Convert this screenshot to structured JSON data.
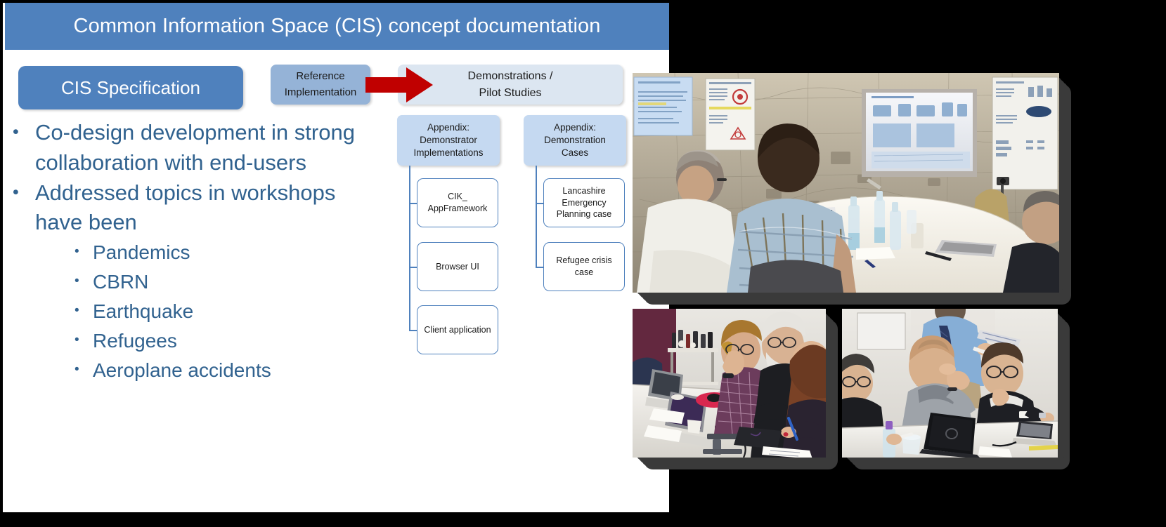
{
  "slide": {
    "title": "Common Information Space (CIS) concept documentation",
    "title_bar_color": "#4f81bd",
    "panel_background": "#ffffff",
    "page_background": "#000000"
  },
  "top_row": {
    "cis_specification": {
      "label": "CIS Specification",
      "color": "#4f81bd",
      "text_color": "#ffffff"
    },
    "reference_implementation": {
      "line1": "Reference",
      "line2": "Implementation",
      "color": "#95b3d7"
    },
    "demonstrations": {
      "line1": "Demonstrations /",
      "line2": "Pilot Studies",
      "color": "#dce6f1"
    },
    "arrow": {
      "name": "right-arrow",
      "color": "#c00000"
    }
  },
  "bullets": {
    "text_color": "#31628f",
    "level1": [
      "Co-design development in strong collaboration with end-users",
      "Addressed topics in workshops have been"
    ],
    "level2": [
      "Pandemics",
      "CBRN",
      "Earthquake",
      "Refugees",
      "Aeroplane accidents"
    ]
  },
  "tree": {
    "header_color": "#c5d9f1",
    "leaf_border_color": "#4f81bd",
    "branches": [
      {
        "header": {
          "line1": "Appendix:",
          "line2": "Demonstrator",
          "line3": "Implementations"
        },
        "leaves": [
          "CIK_ AppFramework",
          "Browser UI",
          "Client application"
        ]
      },
      {
        "header": {
          "line1": "Appendix:",
          "line2": "Demonstration",
          "line3": "Cases"
        },
        "leaves": [
          "Lancashire Emergency Planning case",
          "Refugee crisis case"
        ]
      }
    ]
  },
  "photos": [
    {
      "name": "workshop-presentation-photo",
      "caption_alt": "Workshop participants at a round table watching a projected presentation with maps and posters on the wall"
    },
    {
      "name": "workshop-table-discussion-photo",
      "caption_alt": "Three participants seated at a table with laptops, microphone and notes during a workshop"
    },
    {
      "name": "workshop-laptop-session-photo",
      "caption_alt": "Participants looking at laptops during a classroom workshop session"
    }
  ]
}
